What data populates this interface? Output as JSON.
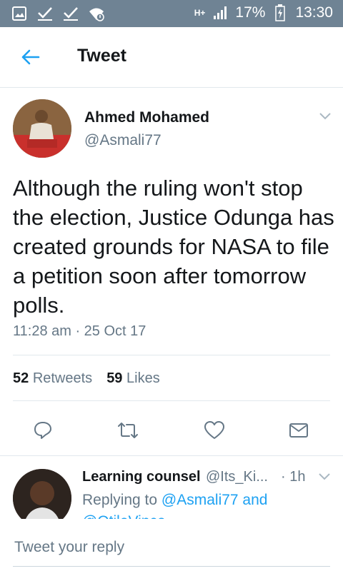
{
  "status_bar": {
    "network": "H+",
    "battery": "17%",
    "time": "13:30"
  },
  "header": {
    "title": "Tweet"
  },
  "tweet": {
    "author_name": "Ahmed Mohamed",
    "author_handle": "@Asmali77",
    "text": "Although the ruling won't stop the election, Justice Odunga has created grounds for NASA to file a petition soon after tomorrow polls.",
    "timestamp": "11:28 am · 25 Oct 17",
    "retweets_count": "52",
    "retweets_label": "Retweets",
    "likes_count": "59",
    "likes_label": "Likes"
  },
  "reply": {
    "author_name": "Learning counsel",
    "author_handle": "@Its_Ki...",
    "time": "· 1h",
    "replying_prefix": "Replying to",
    "replying_to": "@Asmali77 and",
    "replying_more": "@OtileVince"
  },
  "compose": {
    "placeholder": "Tweet your reply"
  },
  "colors": {
    "accent": "#1da1f2",
    "status_bar": "#6f8394",
    "secondary_text": "#657786"
  }
}
